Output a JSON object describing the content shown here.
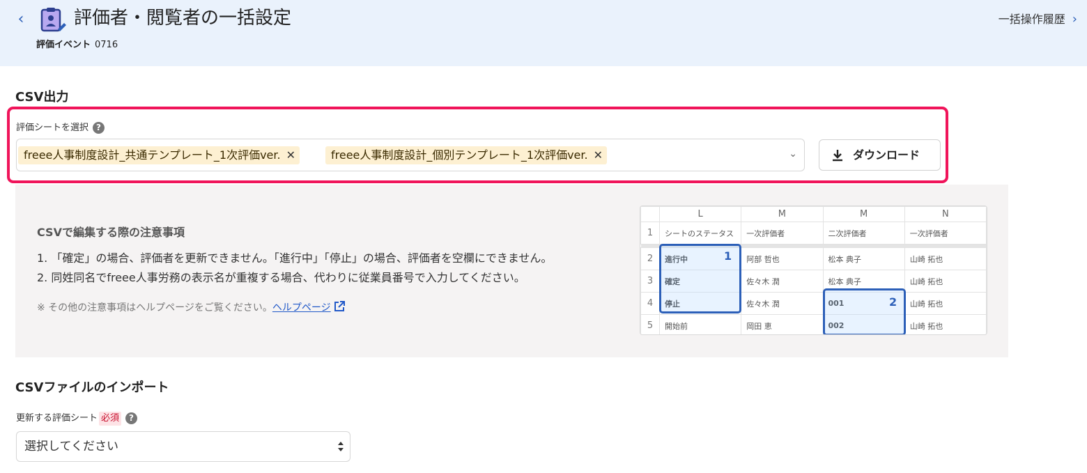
{
  "header": {
    "back_icon": "chevron-left-icon",
    "title_icon": "clipboard-user-edit-icon",
    "title": "評価者・閲覧者の一括設定",
    "event_label": "評価イベント",
    "event_name": "0716",
    "history_link": "一括操作履歴",
    "history_icon": "chevron-right-icon"
  },
  "csv_output": {
    "section_title": "CSV出力",
    "select_label": "評価シートを選択",
    "selected_sheets": [
      "freee人事制度設計_共通テンプレート_1次評価ver.",
      "freee人事制度設計_個別テンプレート_1次評価ver."
    ],
    "download_label": "ダウンロード",
    "accent_color": "#f0145a"
  },
  "notes": {
    "title": "CSVで編集する際の注意事項",
    "items": [
      "1. 「確定」の場合、評価者を更新できません。「進行中」「停止」の場合、評価者を空欄にできません。",
      "2. 同姓同名でfreee人事労務の表示名が重複する場合、代わりに従業員番号で入力してください。"
    ],
    "footnote": "※ その他の注意事項はヘルプページをご覧ください。",
    "help_link": "ヘルプページ"
  },
  "sheet": {
    "columns": [
      "L",
      "M",
      "M",
      "N"
    ],
    "rows": [
      {
        "num": "1",
        "cells": [
          "シートのステータス",
          "一次評価者",
          "二次評価者",
          "一次評価者"
        ]
      },
      {
        "num": "2",
        "cells": [
          "進行中",
          "阿部 哲也",
          "松本 典子",
          "山崎 拓也"
        ]
      },
      {
        "num": "3",
        "cells": [
          "確定",
          "佐々木 潤",
          "松本 典子",
          "山崎 拓也"
        ]
      },
      {
        "num": "4",
        "cells": [
          "停止",
          "佐々木 潤",
          "001",
          "山崎 拓也"
        ]
      },
      {
        "num": "5",
        "cells": [
          "開始前",
          "岡田 恵",
          "002",
          "山崎 拓也"
        ]
      }
    ],
    "badge_1": "1",
    "badge_2": "2"
  },
  "csv_import": {
    "section_title": "CSVファイルのインポート",
    "select_label": "更新する評価シート",
    "required_label": "必須",
    "select_value": "選択してください"
  }
}
